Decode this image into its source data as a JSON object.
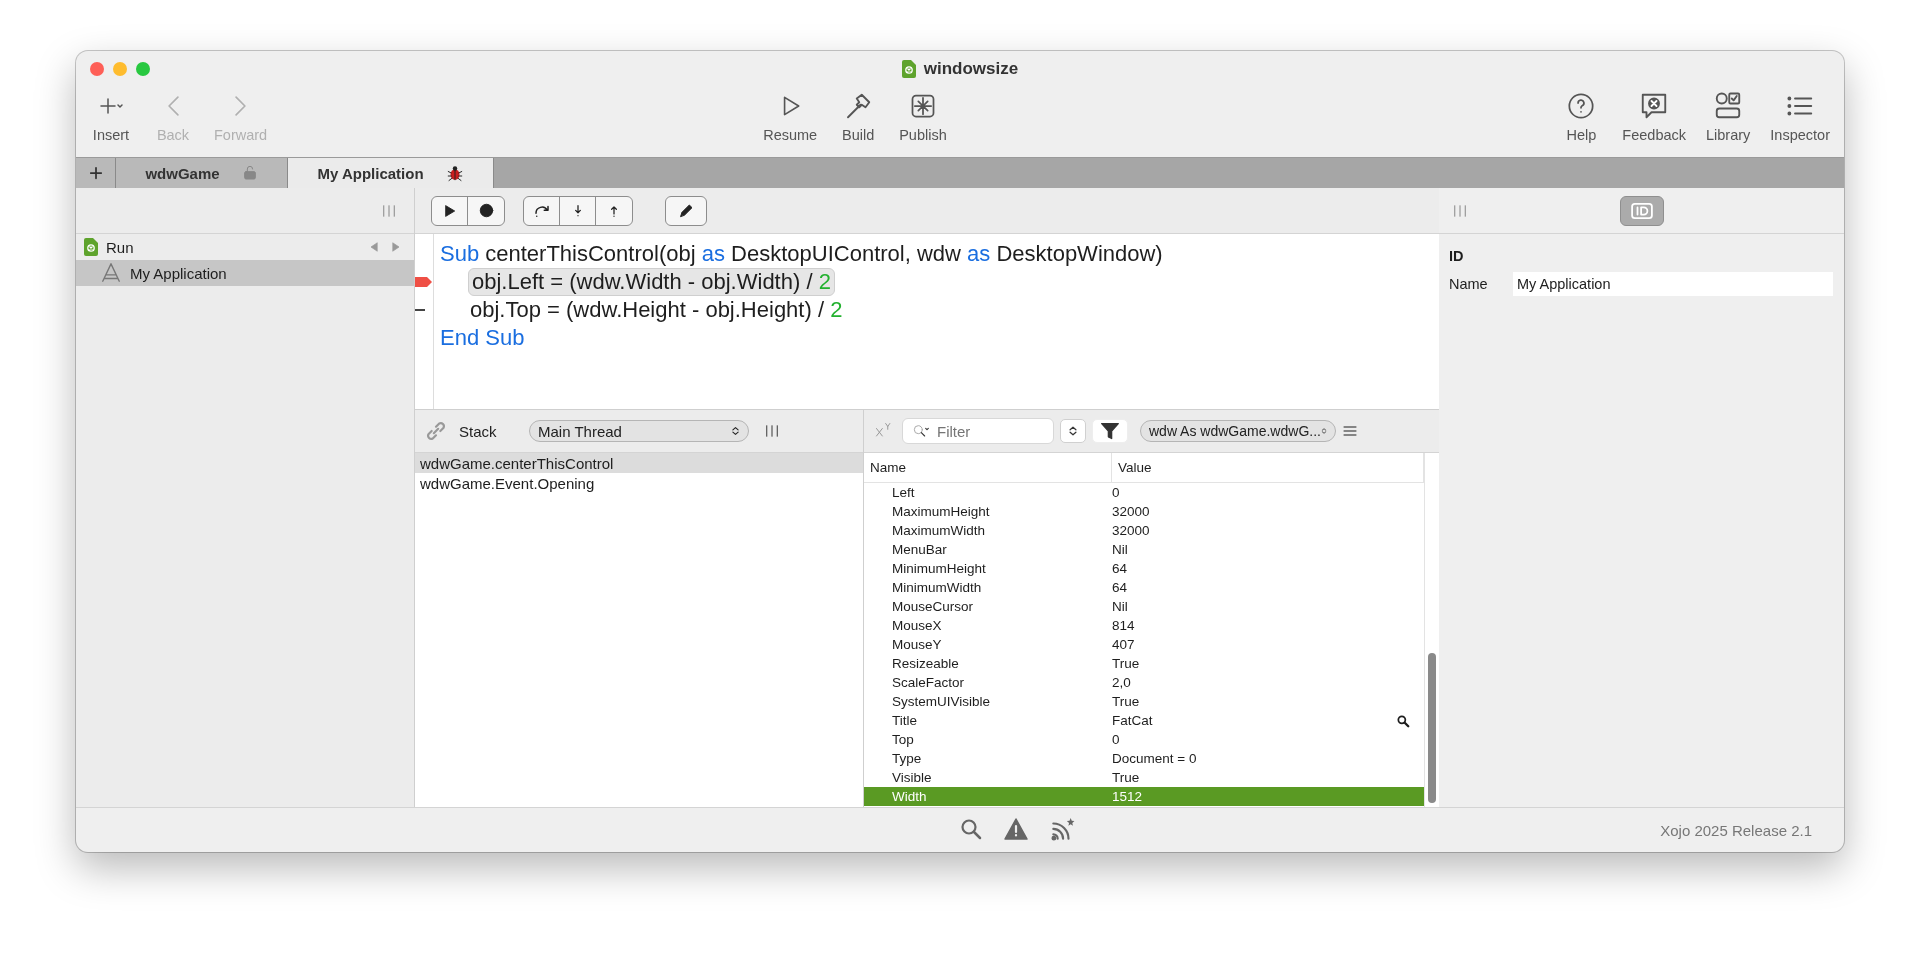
{
  "window": {
    "title": "windowsize"
  },
  "toolbar": {
    "left": [
      {
        "label": "Insert",
        "disabled": false
      },
      {
        "label": "Back",
        "disabled": true
      },
      {
        "label": "Forward",
        "disabled": true
      }
    ],
    "center": [
      {
        "label": "Resume",
        "disabled": false
      },
      {
        "label": "Build",
        "disabled": false
      },
      {
        "label": "Publish",
        "disabled": false
      }
    ],
    "right": [
      {
        "label": "Help",
        "disabled": false
      },
      {
        "label": "Feedback",
        "disabled": false
      },
      {
        "label": "Library",
        "disabled": false
      },
      {
        "label": "Inspector",
        "disabled": false
      }
    ]
  },
  "tabs": [
    {
      "label": "wdwGame",
      "selected": false,
      "locked": true
    },
    {
      "label": "My Application",
      "selected": true,
      "locked": false
    }
  ],
  "sidebar": {
    "items": [
      {
        "label": "Run",
        "children": [
          {
            "label": "My Application",
            "selected": true
          }
        ]
      }
    ]
  },
  "code": {
    "lines": [
      {
        "current": false,
        "marked": false,
        "tokens": [
          {
            "kind": "keyword",
            "text": "Sub"
          },
          {
            "kind": "plain",
            "text": " centerThisControl(obj "
          },
          {
            "kind": "keyword",
            "text": "as"
          },
          {
            "kind": "plain",
            "text": " DesktopUIControl, wdw "
          },
          {
            "kind": "keyword",
            "text": "as"
          },
          {
            "kind": "plain",
            "text": " DesktopWindow)"
          }
        ],
        "children": [
          {
            "current": true,
            "marked": false,
            "tokens": [
              {
                "kind": "plain",
                "text": "obj.Left = (wdw.Width - obj.Width) / "
              },
              {
                "kind": "number",
                "text": "2"
              }
            ]
          },
          {
            "current": false,
            "marked": true,
            "tokens": [
              {
                "kind": "plain",
                "text": "obj.Top = (wdw.Height - obj.Height) / "
              },
              {
                "kind": "number",
                "text": "2"
              }
            ]
          }
        ]
      },
      {
        "current": false,
        "marked": false,
        "tokens": [
          {
            "kind": "keyword",
            "text": "End Sub"
          }
        ]
      }
    ]
  },
  "stack": {
    "title": "Stack",
    "thread": "Main Thread",
    "frames": [
      {
        "label": "wdwGame.centerThisControl",
        "selected": true
      },
      {
        "label": "wdwGame.Event.Opening",
        "selected": false
      }
    ]
  },
  "variables": {
    "filter_placeholder": "Filter",
    "scope": "wdw As wdwGame.wdwG...",
    "columns": [
      "Name",
      "Value"
    ],
    "rows": [
      {
        "name": "Left",
        "value": "0",
        "selected": false,
        "inspectable": false
      },
      {
        "name": "MaximumHeight",
        "value": "32000",
        "selected": false,
        "inspectable": false
      },
      {
        "name": "MaximumWidth",
        "value": "32000",
        "selected": false,
        "inspectable": false
      },
      {
        "name": "MenuBar",
        "value": "Nil",
        "selected": false,
        "inspectable": false
      },
      {
        "name": "MinimumHeight",
        "value": "64",
        "selected": false,
        "inspectable": false
      },
      {
        "name": "MinimumWidth",
        "value": "64",
        "selected": false,
        "inspectable": false
      },
      {
        "name": "MouseCursor",
        "value": "Nil",
        "selected": false,
        "inspectable": false
      },
      {
        "name": "MouseX",
        "value": "814",
        "selected": false,
        "inspectable": false
      },
      {
        "name": "MouseY",
        "value": "407",
        "selected": false,
        "inspectable": false
      },
      {
        "name": "Resizeable",
        "value": "True",
        "selected": false,
        "inspectable": false
      },
      {
        "name": "ScaleFactor",
        "value": "2,0",
        "selected": false,
        "inspectable": false
      },
      {
        "name": "SystemUIVisible",
        "value": "True",
        "selected": false,
        "inspectable": false
      },
      {
        "name": "Title",
        "value": "FatCat",
        "selected": false,
        "inspectable": true
      },
      {
        "name": "Top",
        "value": "0",
        "selected": false,
        "inspectable": false
      },
      {
        "name": "Type",
        "value": "Document = 0",
        "selected": false,
        "inspectable": false
      },
      {
        "name": "Visible",
        "value": "True",
        "selected": false,
        "inspectable": false
      },
      {
        "name": "Width",
        "value": "1512",
        "selected": true,
        "inspectable": false
      }
    ]
  },
  "inspector": {
    "section": "ID",
    "fields": [
      {
        "label": "Name",
        "value": "My Application"
      }
    ]
  },
  "status_bar": {
    "version": "Xojo 2025 Release 2.1"
  }
}
